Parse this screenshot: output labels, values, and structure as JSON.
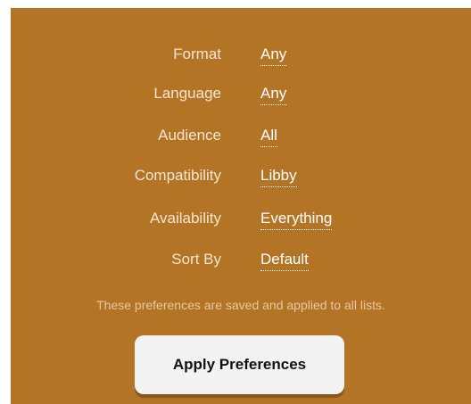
{
  "preferences": [
    {
      "label": "Format",
      "value": "Any"
    },
    {
      "label": "Language",
      "value": "Any"
    },
    {
      "label": "Audience",
      "value": "All"
    },
    {
      "label": "Compatibility",
      "value": "Libby"
    },
    {
      "label": "Availability",
      "value": "Everything"
    },
    {
      "label": "Sort By",
      "value": "Default"
    }
  ],
  "note": "These preferences are saved and applied to all lists.",
  "apply_button": "Apply Preferences",
  "colors": {
    "panel_background": "#b47425",
    "label_text": "#f5e6d2",
    "value_text": "#ffffff",
    "button_background": "#f3f3f3"
  }
}
